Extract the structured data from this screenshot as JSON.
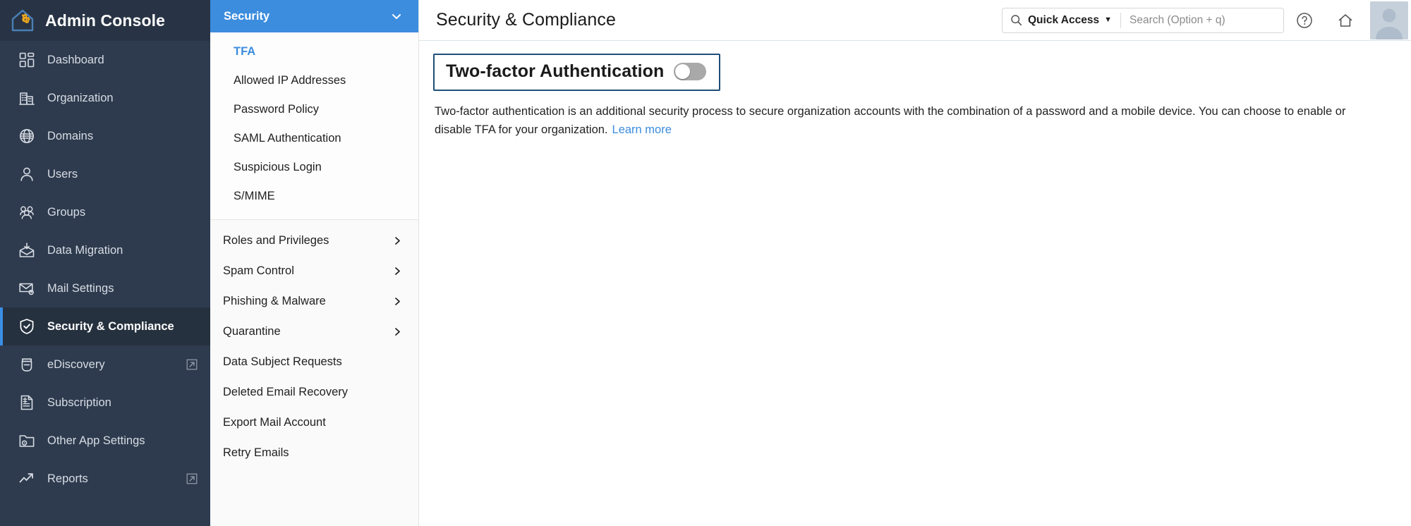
{
  "brand": {
    "title": "Admin Console",
    "logo_icon": "house-gear-icon"
  },
  "sidebar": {
    "items": [
      {
        "label": "Dashboard",
        "icon": "dashboard-grid-icon",
        "external": false,
        "active": false
      },
      {
        "label": "Organization",
        "icon": "building-icon",
        "external": false,
        "active": false
      },
      {
        "label": "Domains",
        "icon": "globe-icon",
        "external": false,
        "active": false
      },
      {
        "label": "Users",
        "icon": "user-icon",
        "external": false,
        "active": false
      },
      {
        "label": "Groups",
        "icon": "users-group-icon",
        "external": false,
        "active": false
      },
      {
        "label": "Data Migration",
        "icon": "mail-download-icon",
        "external": false,
        "active": false
      },
      {
        "label": "Mail Settings",
        "icon": "mail-gear-icon",
        "external": false,
        "active": false
      },
      {
        "label": "Security & Compliance",
        "icon": "shield-check-icon",
        "external": false,
        "active": true
      },
      {
        "label": "eDiscovery",
        "icon": "bag-icon",
        "external": true,
        "active": false
      },
      {
        "label": "Subscription",
        "icon": "invoice-dollar-icon",
        "external": false,
        "active": false
      },
      {
        "label": "Other App Settings",
        "icon": "folder-gear-icon",
        "external": false,
        "active": false
      },
      {
        "label": "Reports",
        "icon": "trend-arrow-icon",
        "external": true,
        "active": false
      }
    ]
  },
  "subnav": {
    "header": {
      "label": "Security",
      "chevron_icon": "chevron-down-icon"
    },
    "group_items": [
      {
        "label": "TFA",
        "selected": true
      },
      {
        "label": "Allowed IP Addresses",
        "selected": false
      },
      {
        "label": "Password Policy",
        "selected": false
      },
      {
        "label": "SAML Authentication",
        "selected": false
      },
      {
        "label": "Suspicious Login",
        "selected": false
      },
      {
        "label": "S/MIME",
        "selected": false
      }
    ],
    "rows": [
      {
        "label": "Roles and Privileges",
        "chevron": true
      },
      {
        "label": "Spam Control",
        "chevron": true
      },
      {
        "label": "Phishing & Malware",
        "chevron": true
      },
      {
        "label": "Quarantine",
        "chevron": true
      },
      {
        "label": "Data Subject Requests",
        "chevron": false
      },
      {
        "label": "Deleted Email Recovery",
        "chevron": false
      },
      {
        "label": "Export Mail Account",
        "chevron": false
      },
      {
        "label": "Retry Emails",
        "chevron": false
      }
    ]
  },
  "topbar": {
    "page_title": "Security & Compliance",
    "quick_access_label": "Quick Access",
    "quick_access_caret": "▼",
    "search_placeholder": "Search (Option + q)",
    "search_value": "",
    "search_icon": "search-icon",
    "help_icon": "help-circle-icon",
    "home_icon": "home-icon",
    "avatar_icon": "avatar"
  },
  "content": {
    "tfa_title": "Two-factor Authentication",
    "toggle_state": "off",
    "description": "Two-factor authentication is an additional security process to secure organization accounts with the combination of a password and a mobile device. You can choose to enable or disable TFA for your organization.",
    "learn_more_label": "Learn more"
  },
  "colors": {
    "sidebar_bg": "#2e3b4e",
    "sidebar_active_bg": "#26313f",
    "accent_blue": "#3c8dde",
    "active_marker": "#3a8ee6",
    "focus_outline": "#1f4e79",
    "logo_house": "#4a7fb5",
    "logo_gear": "#f0a91e"
  }
}
